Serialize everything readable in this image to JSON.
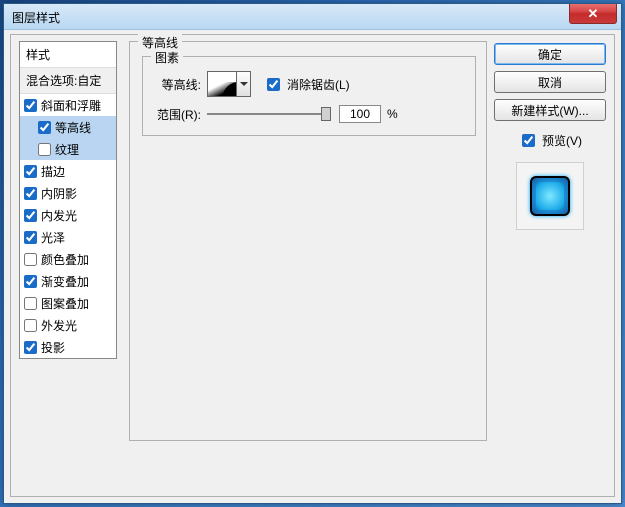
{
  "window": {
    "title": "图层样式"
  },
  "styles": {
    "header": "样式",
    "blend_label": "混合选项:自定",
    "items": [
      {
        "label": "斜面和浮雕",
        "checked": true,
        "indent": false,
        "selected": false
      },
      {
        "label": "等高线",
        "checked": true,
        "indent": true,
        "selected": true
      },
      {
        "label": "纹理",
        "checked": false,
        "indent": true,
        "selected": true
      },
      {
        "label": "描边",
        "checked": true,
        "indent": false,
        "selected": false
      },
      {
        "label": "内阴影",
        "checked": true,
        "indent": false,
        "selected": false
      },
      {
        "label": "内发光",
        "checked": true,
        "indent": false,
        "selected": false
      },
      {
        "label": "光泽",
        "checked": true,
        "indent": false,
        "selected": false
      },
      {
        "label": "颜色叠加",
        "checked": false,
        "indent": false,
        "selected": false
      },
      {
        "label": "渐变叠加",
        "checked": true,
        "indent": false,
        "selected": false
      },
      {
        "label": "图案叠加",
        "checked": false,
        "indent": false,
        "selected": false
      },
      {
        "label": "外发光",
        "checked": false,
        "indent": false,
        "selected": false
      },
      {
        "label": "投影",
        "checked": true,
        "indent": false,
        "selected": false
      }
    ]
  },
  "contour": {
    "legend": "等高线",
    "elements_legend": "图素",
    "contour_label": "等高线:",
    "anti_alias_label": "消除锯齿(L)",
    "anti_alias_checked": true,
    "range_label": "范围(R):",
    "range_value": "100",
    "range_unit": "%"
  },
  "buttons": {
    "ok": "确定",
    "cancel": "取消",
    "new_style": "新建样式(W)...",
    "preview_label": "预览(V)",
    "preview_checked": true
  }
}
